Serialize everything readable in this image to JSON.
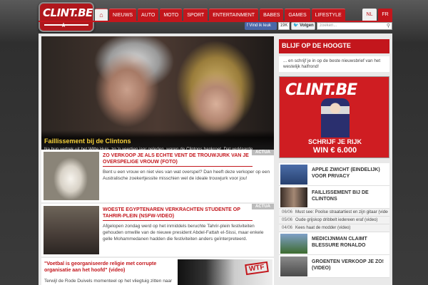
{
  "logo": {
    "text": "CLINT.BE"
  },
  "nav": {
    "home_icon": "home-icon",
    "items": [
      "Nieuws",
      "Auto",
      "Moto",
      "Sport",
      "Entertainment",
      "Babes",
      "Games",
      "Lifestyle"
    ]
  },
  "lang": {
    "nl": "NL",
    "fr": "FR"
  },
  "social": {
    "fb_like": "Vind ik leuk",
    "fb_count": "19K",
    "tw_follow": "Volgen"
  },
  "search": {
    "placeholder": "zoeken..."
  },
  "hero": {
    "title": "Faillissement bij de Clintons",
    "text": "Na hun vertrek uit het Witte Huis, zo 'n veertien jaar geleden, waren de Clintons bankroet. Dat verklaarde Hillary Clinton in een interview met ABC."
  },
  "articles": [
    {
      "tag": "ACTUA",
      "title": "Zo verkoop je als echte vent de trouwjurk van je overspelige vrouw (foto)",
      "text": "Bent u een vrouw en niet vies van wat overspel? Dan heeft deze verkoper op een Australische zoekertjessite misschien wel de ideale trouwjurk voor jou!"
    },
    {
      "tag": "ACTUA",
      "title": "Woeste Egyptenaren verkrachten studente op Tahrir-plein (NSFW-video)",
      "text": "Afgelopen zondag werd op het inmiddels beruchte Tahrir-plein festiviteiten gehouden omwille van de nieuwe president Abdel-Fattah el-Sissi, maar enkele gelle Mohammedanen hadden die festiviteiten anders geïnterpreteerd."
    },
    {
      "title": "\"Voetbal is georganiseerde religie met corrupte organisatie aan het hoofd\" (video)",
      "text": "Terwijl de Rode Duivels momenteel op het vliegtuig zitten naar Brazilië en de voetbalhysterie op het punt staat uit te breken",
      "badge": "WTF"
    }
  ],
  "sidebar": {
    "title": "BLIJF OP DE HOOGTE",
    "subtitle": "... en schrijf je in op de beste nieuwsbrief van het westelijk halfrond!",
    "ad": {
      "logo": "CLINT.BE",
      "line1": "SCHRIJF JE RIJK",
      "line2": "WIN € 6.000"
    },
    "items": [
      {
        "title": "Apple zwicht (eindelijk) voor privacy"
      },
      {
        "title": "Faillissement bij de Clintons"
      }
    ],
    "mini": [
      {
        "date": "06/06",
        "text": "Must see: Poolse straatartiest en zijn gitaar (video)"
      },
      {
        "date": "05/06",
        "text": "Oude grijskop dribbelt iedereen eraf (video)"
      },
      {
        "date": "04/06",
        "text": "Kees haat de modder (video)"
      }
    ],
    "items2": [
      {
        "title": "Medicijnman claimt blessure Ronaldo"
      },
      {
        "title": "Groenten verkoop je zo! (video)"
      }
    ]
  }
}
